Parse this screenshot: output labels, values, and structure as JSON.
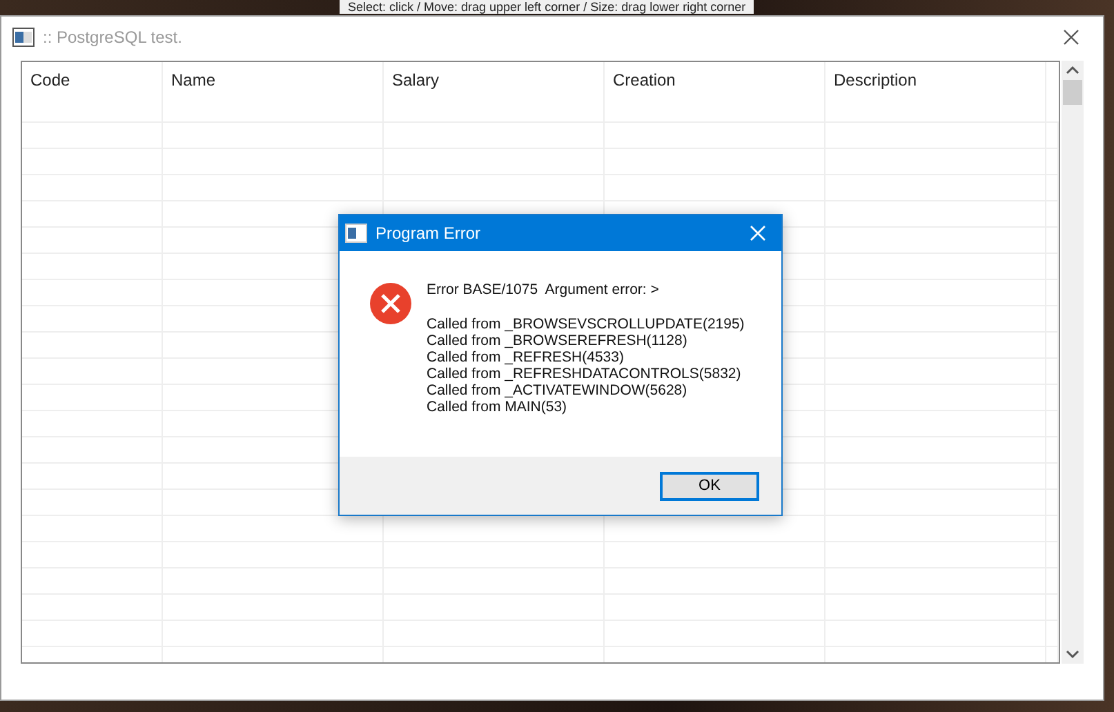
{
  "background_hint": "Select: click / Move: drag upper left corner / Size: drag lower right corner",
  "window": {
    "title": ":: PostgreSQL test."
  },
  "table": {
    "columns": [
      "Code",
      "Name",
      "Salary",
      "Creation",
      "Description"
    ]
  },
  "dialog": {
    "title": "Program Error",
    "message": "Error BASE/1075  Argument error: >",
    "call_stack": [
      "Called from _BROWSEVSCROLLUPDATE(2195)",
      "Called from _BROWSEREFRESH(1128)",
      "Called from _REFRESH(4533)",
      "Called from _REFRESHDATACONTROLS(5832)",
      "Called from _ACTIVATEWINDOW(5628)",
      "Called from MAIN(53)"
    ],
    "buttons": [
      {
        "label": "OK",
        "focused": true
      }
    ]
  }
}
